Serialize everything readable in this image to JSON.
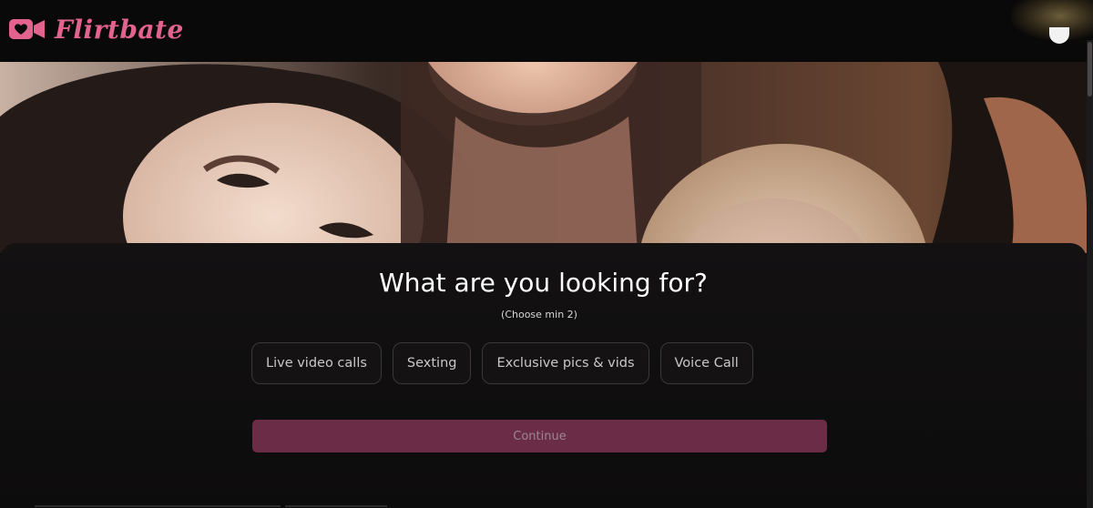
{
  "brand": {
    "name": "Flirtbate",
    "color": "#e2638e",
    "icon": "video-heart-icon"
  },
  "hero": {
    "image": "group-photo-of-women"
  },
  "question": {
    "title": "What are you looking for?",
    "hint": "(Choose min 2)"
  },
  "options": [
    {
      "label": "Live video calls"
    },
    {
      "label": "Sexting"
    },
    {
      "label": "Exclusive pics & vids"
    },
    {
      "label": "Voice Call"
    }
  ],
  "continue_button": {
    "label": "Continue",
    "color": "#6b2c48"
  }
}
